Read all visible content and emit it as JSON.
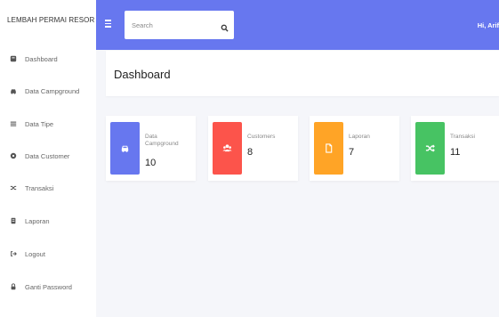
{
  "sidebar": {
    "brand": "LEMBAH PERMAI RESOR",
    "items": [
      {
        "label": "Dashboard",
        "icon": "dashboard-icon"
      },
      {
        "label": "Data Campground",
        "icon": "campground-icon"
      },
      {
        "label": "Data Tipe",
        "icon": "list-icon"
      },
      {
        "label": "Data Customer",
        "icon": "customer-icon"
      },
      {
        "label": "Transaksi",
        "icon": "shuffle-icon"
      },
      {
        "label": "Laporan",
        "icon": "report-icon"
      },
      {
        "label": "Logout",
        "icon": "logout-icon"
      },
      {
        "label": "Ganti Password",
        "icon": "lock-icon"
      }
    ]
  },
  "topbar": {
    "search_placeholder": "Search",
    "greeting": "Hi, Arif"
  },
  "page": {
    "title": "Dashboard"
  },
  "stats": [
    {
      "label_line1": "Data",
      "label_line2": "Campground",
      "value": "10",
      "color": "#6777ef",
      "icon": "car-icon"
    },
    {
      "label_line1": "Customers",
      "label_line2": "",
      "value": "8",
      "color": "#fc544b",
      "icon": "users-icon"
    },
    {
      "label_line1": "Laporan",
      "label_line2": "",
      "value": "7",
      "color": "#ffa426",
      "icon": "file-icon"
    },
    {
      "label_line1": "Transaksi",
      "label_line2": "",
      "value": "11",
      "color": "#47c363",
      "icon": "shuffle-icon"
    }
  ],
  "colors": {
    "primary": "#6777ef",
    "background": "#f5f6fa"
  }
}
